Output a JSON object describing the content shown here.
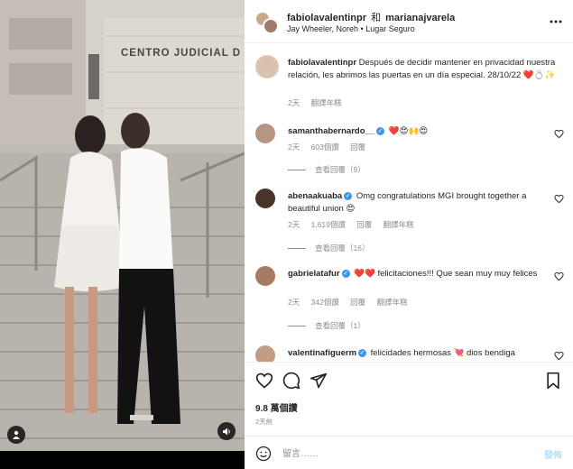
{
  "photo": {
    "building_sign": "CENTRO JUDICIAL D"
  },
  "header": {
    "user1": "fabiolavalentinpr",
    "and": "和",
    "user2": "marianajvarela",
    "subtitle": "Jay Wheeler, Noreh • Lugar Seguro",
    "more_icon": "more-icon"
  },
  "caption": {
    "username": "fabiolavalentinpr",
    "text": "Después de decidir mantener en privacidad nuestra relación, les abrimos las puertas en un día especial. 28/10/22 ❤️💍✨",
    "time": "2天",
    "translate": "翻譯年糕"
  },
  "comments": [
    {
      "username": "samanthabernardo__",
      "verified": true,
      "text": "❤️😍🙌😍",
      "time": "2天",
      "likes": "603個讚",
      "reply": "回覆",
      "translate": "",
      "replies": "查看回覆（9）",
      "avatar_color": "#b89580"
    },
    {
      "username": "abenaakuaba",
      "verified": true,
      "text": "Omg congratulations MGI brought together a beautiful union 😍",
      "time": "2天",
      "likes": "1,619個讚",
      "reply": "回覆",
      "translate": "翻譯年糕",
      "replies": "查看回覆（16）",
      "avatar_color": "#4a3328"
    },
    {
      "username": "gabrielatafur",
      "verified": true,
      "text": "❤️❤️ felicitaciones!!! Que sean muy muy felices",
      "time": "2天",
      "likes": "342個讚",
      "reply": "回覆",
      "translate": "翻譯年糕",
      "replies": "查看回覆（1）",
      "avatar_color": "#a67b62"
    },
    {
      "username": "valentinafiguerm",
      "verified": true,
      "text": "felicidades hermosas 💘 dios bendiga",
      "time": "",
      "likes": "",
      "reply": "",
      "translate": "",
      "replies": "",
      "avatar_color": "#c29d83"
    }
  ],
  "actions": {
    "like_icon": "heart-icon",
    "comment_icon": "comment-icon",
    "share_icon": "share-icon",
    "save_icon": "bookmark-icon",
    "views": "9.8 萬個讚",
    "post_time": "2天前"
  },
  "comment_bar": {
    "placeholder": "留言……",
    "post_label": "發佈"
  },
  "colors": {
    "verified": "#3897f0",
    "heart": "#ed4956",
    "post_disabled": "#b2dffc",
    "muted_text": "#8e8e8e"
  }
}
